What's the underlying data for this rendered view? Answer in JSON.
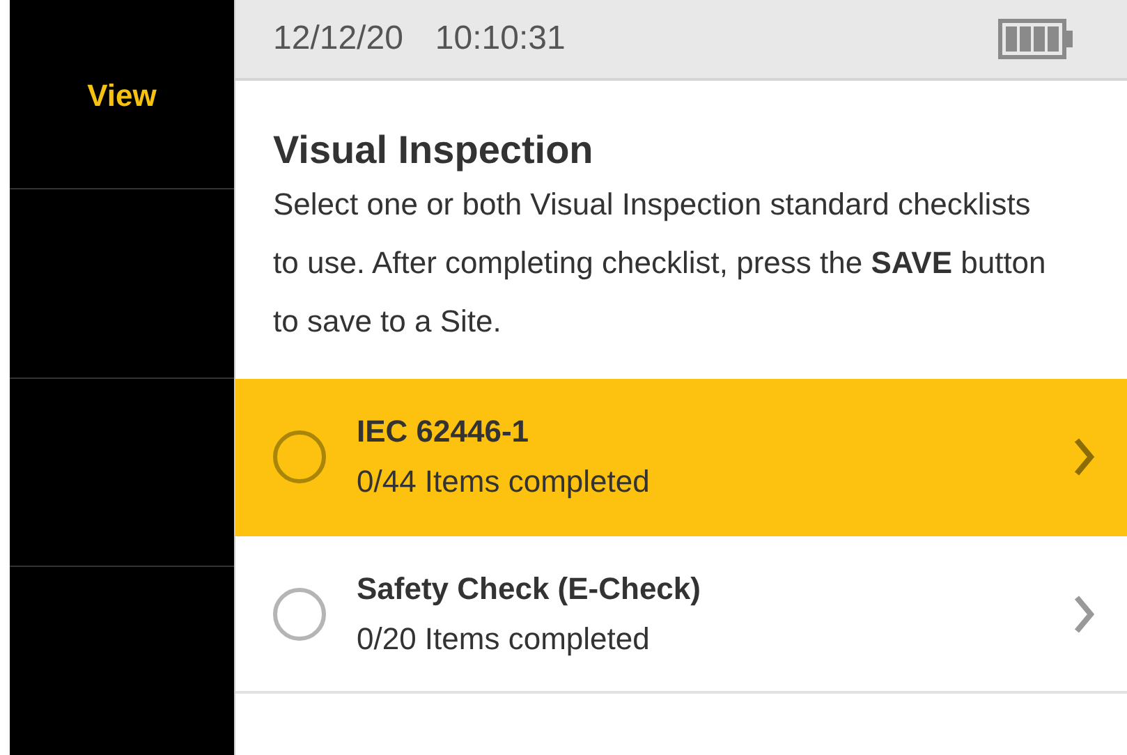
{
  "softkeys": [
    {
      "label": "View"
    }
  ],
  "status_bar": {
    "date": "12/12/20",
    "time": "10:10:31"
  },
  "title": "Visual Inspection",
  "description": "Select one or both Visual Inspection standard checklists to use. After completing checklist, press the **SAVE** button to save to a Site.",
  "checklists": [
    {
      "name": "IEC 62446-1",
      "progress": "0/44 Items completed",
      "selected": true,
      "checked": false
    },
    {
      "name": "Safety Check (E-Check)",
      "progress": "0/20 Items completed",
      "selected": false,
      "checked": false
    }
  ]
}
